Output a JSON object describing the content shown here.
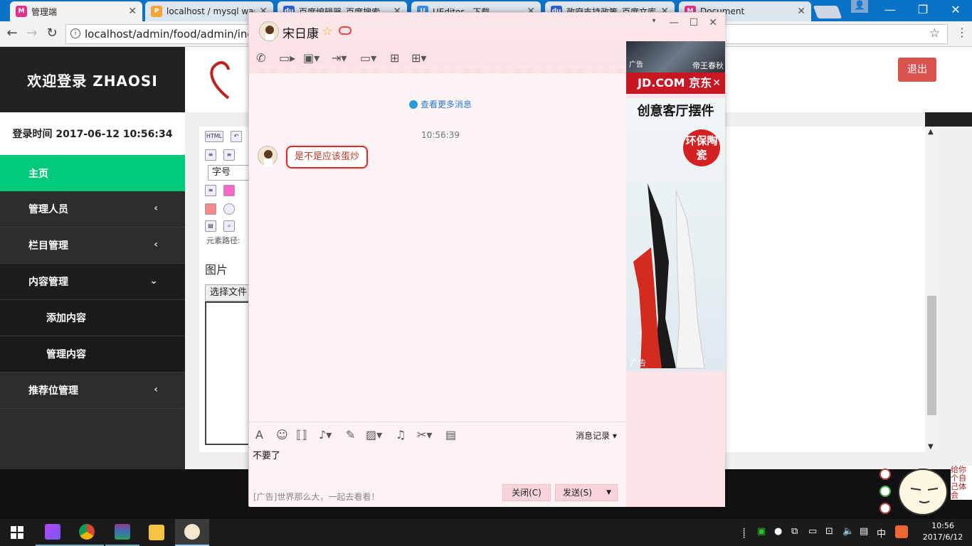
{
  "browser": {
    "tabs": [
      {
        "title": "管理端",
        "icon": "admin-favicon"
      },
      {
        "title": "localhost / mysql wam",
        "icon": "phpmyadmin-favicon"
      },
      {
        "title": "百度编辑器_百度搜索",
        "icon": "baidu-favicon"
      },
      {
        "title": "UEditor - 下载",
        "icon": "ueditor-favicon"
      },
      {
        "title": "政府支持政策_百度文库",
        "icon": "baidu-favicon"
      },
      {
        "title": "Document",
        "icon": "document-favicon"
      }
    ],
    "url": "localhost/admin/food/admin/inde"
  },
  "admin": {
    "brand": "欢迎登录 ZHAOSI",
    "login_time": "登录时间 2017-06-12 10:56:34",
    "menu": [
      {
        "label": "主页"
      },
      {
        "label": "管理人员"
      },
      {
        "label": "栏目管理"
      },
      {
        "label": "内容管理"
      },
      {
        "label": "添加内容"
      },
      {
        "label": "管理内容"
      },
      {
        "label": "推荐位管理"
      }
    ],
    "logout": "退出",
    "editor": {
      "font_size_placeholder": "字号",
      "html_label": "HTML",
      "path_label": "元素路径:"
    },
    "image_label": "图片",
    "file_button": "选择文件"
  },
  "chat": {
    "contact_name": "宋日康",
    "more_messages": "查看更多消息",
    "timestamp": "10:56:39",
    "messages": [
      {
        "text": "是不是应该蛋炒"
      }
    ],
    "history_label": "消息记录",
    "input_text": "不要了",
    "ad_text": "[广告]世界那么大，一起去看看！",
    "close_label": "关闭(C)",
    "send_label": "发送(S)",
    "ads": {
      "game_tag": "广告",
      "game_title": "帝王春秋",
      "jd_label": "JD.COM 京东",
      "vase_title": "创意客厅摆件",
      "vase_badge": "环保陶瓷",
      "vase_tag": "广告"
    }
  },
  "pet": {
    "speech": "给你个自己体会"
  },
  "taskbar": {
    "ime": "中",
    "time": "10:56",
    "date": "2017/6/12"
  },
  "colors": {
    "sidebar_active": "#00c97a",
    "logout_button": "#d9534f",
    "chat_bubble_border": "#d42b2b",
    "browser_frame": "#0a73c8"
  }
}
